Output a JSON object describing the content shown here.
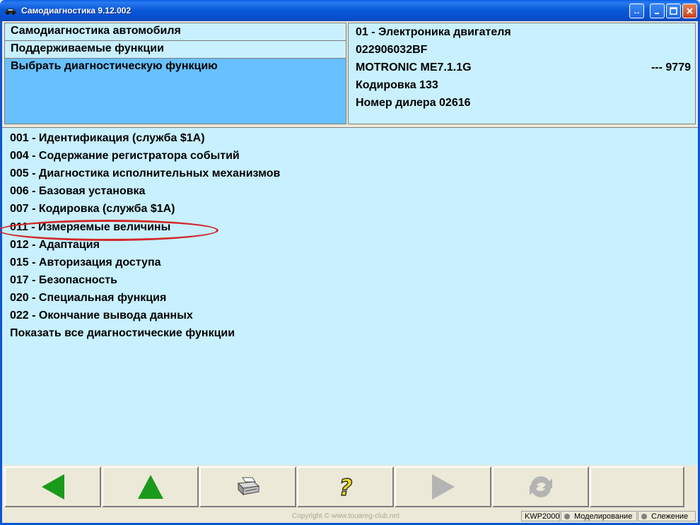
{
  "window": {
    "title": "Самодиагностика 9.12.002"
  },
  "nav": {
    "items": [
      {
        "label": "Самодиагностика автомобиля",
        "selected": false
      },
      {
        "label": "Поддерживаемые функции",
        "selected": false
      },
      {
        "label": "Выбрать диагностическую функцию",
        "selected": true
      }
    ]
  },
  "controller": {
    "address": "01 - Электроника двигателя",
    "part_number": "022906032BF",
    "system": "MOTRONIC ME7.1.1G",
    "system_suffix": "---  9779",
    "coding": "Кодировка 133",
    "dealer": "Номер дилера 02616"
  },
  "functions": [
    "001 - Идентификация (служба $1A)",
    "004 - Содержание регистратора событий",
    "005 - Диагностика исполнительных механизмов",
    "006 - Базовая установка",
    "007 - Кодировка (служба $1A)",
    "011 - Измеряемые величины",
    "012 - Адаптация",
    "015 - Авторизация доступа",
    "017 - Безопасность",
    "020 - Специальная функция",
    "022 - Окончание вывода данных",
    "Показать все диагностические функции"
  ],
  "highlighted_function": "011 - Измеряемые величины",
  "toolbar": {
    "buttons": [
      {
        "icon": "arrow-left-icon",
        "enabled": true
      },
      {
        "icon": "arrow-up-icon",
        "enabled": true
      },
      {
        "icon": "printer-icon",
        "enabled": true
      },
      {
        "icon": "help-icon",
        "enabled": true
      },
      {
        "icon": "arrow-right-icon",
        "enabled": false
      },
      {
        "icon": "refresh-icon",
        "enabled": false
      }
    ]
  },
  "status": {
    "copyright": "Copyright © www.touareg-club.net",
    "protocol": "KWP2000",
    "mode1": "Моделирование",
    "mode2": "Слежение"
  },
  "colors": {
    "panel_bg": "#c8f0ff",
    "selected_bg": "#68c0ff",
    "arrow_green": "#1a9a1a",
    "highlight_ring": "#d42828"
  }
}
